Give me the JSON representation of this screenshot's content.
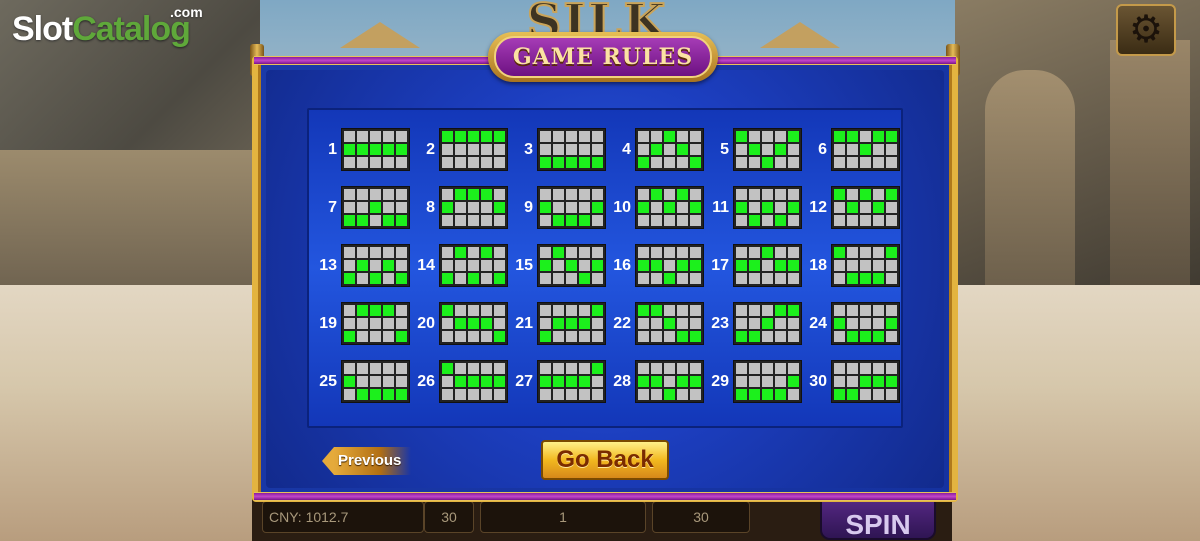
{
  "watermark": {
    "part1": "Slot",
    "part2": "Catalog",
    "suffix": ".com"
  },
  "game": {
    "title": "SILK ROAD"
  },
  "dialog": {
    "title": "GAME RULES",
    "previous_label": "Previous",
    "go_back_label": "Go Back"
  },
  "bottom_bar": {
    "balance": "CNY: 1012.7",
    "lines": "30",
    "bet": "1",
    "total": "30",
    "spin_label": "SPIN"
  },
  "paylines": [
    {
      "n": "1",
      "rows": [
        [
          0,
          0,
          0,
          0,
          0
        ],
        [
          1,
          1,
          1,
          1,
          1
        ],
        [
          0,
          0,
          0,
          0,
          0
        ]
      ]
    },
    {
      "n": "2",
      "rows": [
        [
          1,
          1,
          1,
          1,
          1
        ],
        [
          0,
          0,
          0,
          0,
          0
        ],
        [
          0,
          0,
          0,
          0,
          0
        ]
      ]
    },
    {
      "n": "3",
      "rows": [
        [
          0,
          0,
          0,
          0,
          0
        ],
        [
          0,
          0,
          0,
          0,
          0
        ],
        [
          1,
          1,
          1,
          1,
          1
        ]
      ]
    },
    {
      "n": "4",
      "rows": [
        [
          0,
          0,
          1,
          0,
          0
        ],
        [
          0,
          1,
          0,
          1,
          0
        ],
        [
          1,
          0,
          0,
          0,
          1
        ]
      ]
    },
    {
      "n": "5",
      "rows": [
        [
          1,
          0,
          0,
          0,
          1
        ],
        [
          0,
          1,
          0,
          1,
          0
        ],
        [
          0,
          0,
          1,
          0,
          0
        ]
      ]
    },
    {
      "n": "6",
      "rows": [
        [
          1,
          1,
          0,
          1,
          1
        ],
        [
          0,
          0,
          1,
          0,
          0
        ],
        [
          0,
          0,
          0,
          0,
          0
        ]
      ]
    },
    {
      "n": "7",
      "rows": [
        [
          0,
          0,
          0,
          0,
          0
        ],
        [
          0,
          0,
          1,
          0,
          0
        ],
        [
          1,
          1,
          0,
          1,
          1
        ]
      ]
    },
    {
      "n": "8",
      "rows": [
        [
          0,
          1,
          1,
          1,
          0
        ],
        [
          1,
          0,
          0,
          0,
          1
        ],
        [
          0,
          0,
          0,
          0,
          0
        ]
      ]
    },
    {
      "n": "9",
      "rows": [
        [
          0,
          0,
          0,
          0,
          0
        ],
        [
          1,
          0,
          0,
          0,
          1
        ],
        [
          0,
          1,
          1,
          1,
          0
        ]
      ]
    },
    {
      "n": "10",
      "rows": [
        [
          0,
          1,
          0,
          1,
          0
        ],
        [
          1,
          0,
          1,
          0,
          1
        ],
        [
          0,
          0,
          0,
          0,
          0
        ]
      ]
    },
    {
      "n": "11",
      "rows": [
        [
          0,
          0,
          0,
          0,
          0
        ],
        [
          1,
          0,
          1,
          0,
          1
        ],
        [
          0,
          1,
          0,
          1,
          0
        ]
      ]
    },
    {
      "n": "12",
      "rows": [
        [
          1,
          0,
          1,
          0,
          1
        ],
        [
          0,
          1,
          0,
          1,
          0
        ],
        [
          0,
          0,
          0,
          0,
          0
        ]
      ]
    },
    {
      "n": "13",
      "rows": [
        [
          0,
          0,
          0,
          0,
          0
        ],
        [
          0,
          1,
          0,
          1,
          0
        ],
        [
          1,
          0,
          1,
          0,
          1
        ]
      ]
    },
    {
      "n": "14",
      "rows": [
        [
          0,
          1,
          0,
          1,
          0
        ],
        [
          0,
          0,
          0,
          0,
          0
        ],
        [
          1,
          0,
          1,
          0,
          1
        ]
      ]
    },
    {
      "n": "15",
      "rows": [
        [
          0,
          1,
          0,
          0,
          0
        ],
        [
          1,
          0,
          1,
          0,
          1
        ],
        [
          0,
          0,
          0,
          1,
          0
        ]
      ]
    },
    {
      "n": "16",
      "rows": [
        [
          0,
          0,
          0,
          0,
          0
        ],
        [
          1,
          1,
          0,
          1,
          1
        ],
        [
          0,
          0,
          1,
          0,
          0
        ]
      ]
    },
    {
      "n": "17",
      "rows": [
        [
          0,
          0,
          1,
          0,
          0
        ],
        [
          1,
          1,
          0,
          1,
          1
        ],
        [
          0,
          0,
          0,
          0,
          0
        ]
      ]
    },
    {
      "n": "18",
      "rows": [
        [
          1,
          0,
          0,
          0,
          1
        ],
        [
          0,
          0,
          0,
          0,
          0
        ],
        [
          0,
          1,
          1,
          1,
          0
        ]
      ]
    },
    {
      "n": "19",
      "rows": [
        [
          0,
          1,
          1,
          1,
          0
        ],
        [
          0,
          0,
          0,
          0,
          0
        ],
        [
          1,
          0,
          0,
          0,
          1
        ]
      ]
    },
    {
      "n": "20",
      "rows": [
        [
          1,
          0,
          0,
          0,
          0
        ],
        [
          0,
          1,
          1,
          1,
          0
        ],
        [
          0,
          0,
          0,
          0,
          1
        ]
      ]
    },
    {
      "n": "21",
      "rows": [
        [
          0,
          0,
          0,
          0,
          1
        ],
        [
          0,
          1,
          1,
          1,
          0
        ],
        [
          1,
          0,
          0,
          0,
          0
        ]
      ]
    },
    {
      "n": "22",
      "rows": [
        [
          1,
          1,
          0,
          0,
          0
        ],
        [
          0,
          0,
          1,
          0,
          0
        ],
        [
          0,
          0,
          0,
          1,
          1
        ]
      ]
    },
    {
      "n": "23",
      "rows": [
        [
          0,
          0,
          0,
          1,
          1
        ],
        [
          0,
          0,
          1,
          0,
          0
        ],
        [
          1,
          1,
          0,
          0,
          0
        ]
      ]
    },
    {
      "n": "24",
      "rows": [
        [
          0,
          0,
          0,
          0,
          0
        ],
        [
          1,
          0,
          0,
          0,
          1
        ],
        [
          0,
          1,
          1,
          1,
          0
        ]
      ]
    },
    {
      "n": "25",
      "rows": [
        [
          0,
          0,
          0,
          0,
          0
        ],
        [
          1,
          0,
          0,
          0,
          0
        ],
        [
          0,
          1,
          1,
          1,
          1
        ]
      ]
    },
    {
      "n": "26",
      "rows": [
        [
          1,
          0,
          0,
          0,
          0
        ],
        [
          0,
          1,
          1,
          1,
          1
        ],
        [
          0,
          0,
          0,
          0,
          0
        ]
      ]
    },
    {
      "n": "27",
      "rows": [
        [
          0,
          0,
          0,
          0,
          1
        ],
        [
          1,
          1,
          1,
          1,
          0
        ],
        [
          0,
          0,
          0,
          0,
          0
        ]
      ]
    },
    {
      "n": "28",
      "rows": [
        [
          0,
          0,
          0,
          0,
          0
        ],
        [
          1,
          1,
          0,
          1,
          1
        ],
        [
          0,
          0,
          1,
          0,
          0
        ]
      ]
    },
    {
      "n": "29",
      "rows": [
        [
          0,
          0,
          0,
          0,
          0
        ],
        [
          0,
          0,
          0,
          0,
          1
        ],
        [
          1,
          1,
          1,
          1,
          0
        ]
      ]
    },
    {
      "n": "30",
      "rows": [
        [
          0,
          0,
          0,
          0,
          0
        ],
        [
          0,
          0,
          1,
          1,
          1
        ],
        [
          1,
          1,
          0,
          0,
          0
        ]
      ]
    }
  ],
  "colors": {
    "active_cell": "#1cf01c",
    "inactive_cell": "#c2c2c2",
    "panel_blue": "#1c3ebf",
    "gold": "#e3b440",
    "purple": "#8a1ca0"
  },
  "icons": {
    "settings": "gear-icon",
    "previous": "arrow-left-icon"
  }
}
